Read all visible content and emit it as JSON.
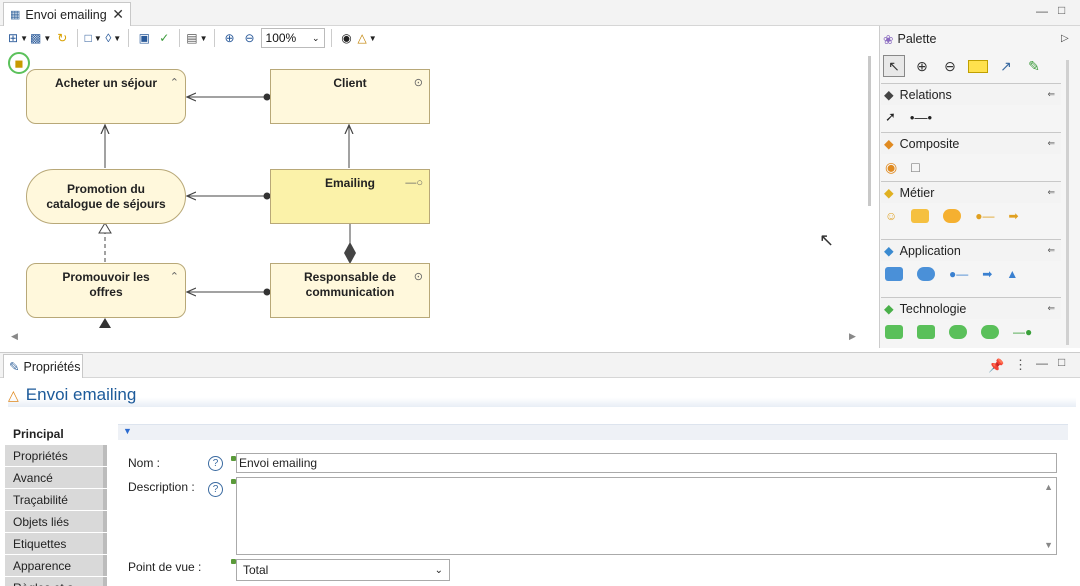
{
  "editor": {
    "tab_title": "Envoi emailing",
    "zoom": "100%"
  },
  "diagram": {
    "nodes": [
      {
        "id": "acheter",
        "label": "Acheter un séjour"
      },
      {
        "id": "client",
        "label": "Client"
      },
      {
        "id": "promotion",
        "label": "Promotion du\ncatalogue de séjours"
      },
      {
        "id": "emailing",
        "label": "Emailing"
      },
      {
        "id": "promouvoir",
        "label": "Promouvoir les\noffres"
      },
      {
        "id": "responsable",
        "label": "Responsable de\ncommunication"
      }
    ]
  },
  "palette": {
    "title": "Palette",
    "drawers": [
      {
        "label": "Relations"
      },
      {
        "label": "Composite"
      },
      {
        "label": "Métier"
      },
      {
        "label": "Application"
      },
      {
        "label": "Technologie"
      }
    ]
  },
  "properties": {
    "tab_title": "Propriétés",
    "element_title": "Envoi emailing",
    "side_tabs": [
      "Principal",
      "Propriétés",
      "Avancé",
      "Traçabilité",
      "Objets liés",
      "Etiquettes",
      "Apparence",
      "Règles et a..."
    ],
    "fields": {
      "name_label": "Nom :",
      "name_value": "Envoi emailing",
      "description_label": "Description :",
      "description_value": "",
      "viewpoint_label": "Point de vue :",
      "viewpoint_value": "Total"
    }
  },
  "colors": {
    "node_fill": "#fff8dc",
    "node_selected_fill": "#fbf2a9",
    "title_blue": "#1c5a9a"
  }
}
